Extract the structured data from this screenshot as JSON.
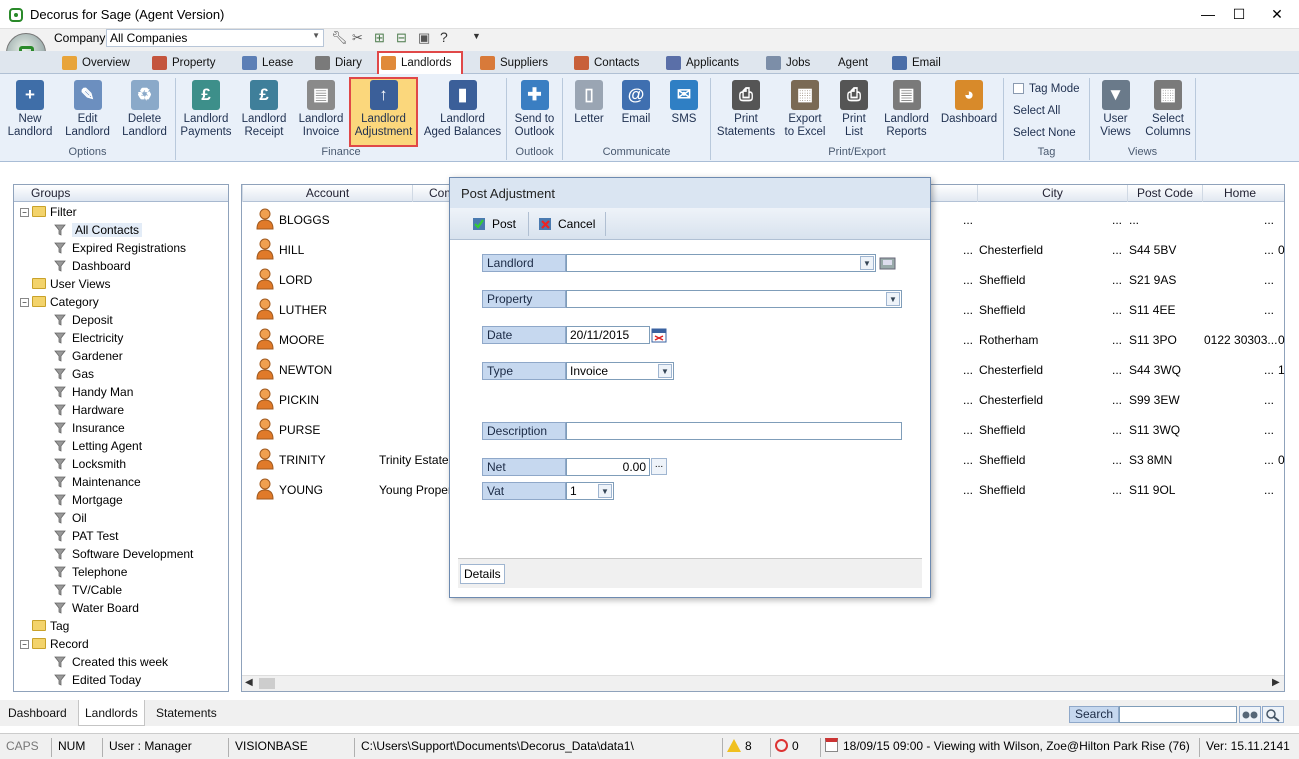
{
  "app": {
    "title": "Decorus for Sage (Agent Version)"
  },
  "window": {
    "minimize": "—",
    "maximize": "☐",
    "close": "✕"
  },
  "qat": {
    "company_label": "Company",
    "company_value": "All Companies"
  },
  "tabs": [
    {
      "label": "Overview",
      "color": "#e8a43a"
    },
    {
      "label": "Property",
      "color": "#c4553e"
    },
    {
      "label": "Lease",
      "color": "#5c7fb6"
    },
    {
      "label": "Diary",
      "color": "#7a7a7a"
    },
    {
      "label": "Landlords",
      "color": "#e08a3a",
      "active": true
    },
    {
      "label": "Suppliers",
      "color": "#d87a3a"
    },
    {
      "label": "Contacts",
      "color": "#c8603a"
    },
    {
      "label": "Applicants",
      "color": "#5a6fa8"
    },
    {
      "label": "Jobs",
      "color": "#7c8ea8"
    },
    {
      "label": "Agent",
      "color": ""
    },
    {
      "label": "Email",
      "color": "#4a6ea8"
    }
  ],
  "ribbon": {
    "buttons": [
      {
        "label": "New\nLandlord",
        "icon": "new-landlord-icon",
        "color": "#3f6ea8",
        "glyph": "+"
      },
      {
        "label": "Edit\nLandlord",
        "icon": "edit-landlord-icon",
        "color": "#6c8fbf",
        "glyph": "✎"
      },
      {
        "label": "Delete\nLandlord",
        "icon": "delete-landlord-icon",
        "color": "#8aa9c9",
        "glyph": "♻"
      },
      {
        "label": "Landlord\nPayments",
        "icon": "landlord-payments-icon",
        "color": "#3d8f8a",
        "glyph": "£"
      },
      {
        "label": "Landlord\nReceipt",
        "icon": "landlord-receipt-icon",
        "color": "#3f7f9a",
        "glyph": "£"
      },
      {
        "label": "Landlord\nInvoice",
        "icon": "landlord-invoice-icon",
        "color": "#8a8a8a",
        "glyph": "▤"
      },
      {
        "label": "Landlord\nAdjustment",
        "icon": "landlord-adjustment-icon",
        "color": "#3b5f99",
        "glyph": "↑"
      },
      {
        "label": "Landlord\nAged Balances",
        "icon": "aged-balances-icon",
        "color": "#3b5f99",
        "glyph": "▮"
      },
      {
        "label": "Send to\nOutlook",
        "icon": "send-to-outlook-icon",
        "color": "#3a7ec2",
        "glyph": "✚"
      },
      {
        "label": "Letter",
        "icon": "letter-icon",
        "color": "#9aa5b3",
        "glyph": "▯"
      },
      {
        "label": "Email",
        "icon": "email-icon",
        "color": "#3f6fb0",
        "glyph": "@"
      },
      {
        "label": "SMS",
        "icon": "sms-icon",
        "color": "#2f7fc4",
        "glyph": "✉"
      },
      {
        "label": "Print\nStatements",
        "icon": "print-statements-icon",
        "color": "#555",
        "glyph": "⎙"
      },
      {
        "label": "Export\nto Excel",
        "icon": "export-excel-icon",
        "color": "#7a6a55",
        "glyph": "▦"
      },
      {
        "label": "Print\nList",
        "icon": "print-list-icon",
        "color": "#555",
        "glyph": "⎙"
      },
      {
        "label": "Landlord\nReports",
        "icon": "landlord-reports-icon",
        "color": "#7a7a7a",
        "glyph": "▤"
      },
      {
        "label": "Dashboard",
        "icon": "dashboard-icon",
        "color": "#d88a2a",
        "glyph": "◕"
      },
      {
        "label": "User\nViews",
        "icon": "user-views-icon",
        "color": "#6a7a8a",
        "glyph": "▼"
      },
      {
        "label": "Select\nColumns",
        "icon": "select-columns-icon",
        "color": "#7a7a7a",
        "glyph": "▦"
      }
    ],
    "tag_mode": "Tag Mode",
    "select_all": "Select All",
    "select_none": "Select None",
    "groups": [
      "Options",
      "Finance",
      "Outlook",
      "Communicate",
      "Print/Export",
      "Tag",
      "Views"
    ]
  },
  "groups_panel": {
    "header": "Groups",
    "filter": "Filter",
    "filter_items": [
      "All Contacts",
      "Expired Registrations",
      "Dashboard"
    ],
    "user_views": "User Views",
    "category": "Category",
    "category_items": [
      "Deposit",
      "Electricity",
      "Gardener",
      "Gas",
      "Handy Man",
      "Hardware",
      "Insurance",
      "Letting Agent",
      "Locksmith",
      "Maintenance",
      "Mortgage",
      "Oil",
      "PAT Test",
      "Software Development",
      "Telephone",
      "TV/Cable",
      "Water Board"
    ],
    "tag": "Tag",
    "record": "Record",
    "record_items": [
      "Created this week",
      "Edited Today"
    ]
  },
  "grid": {
    "columns": {
      "account": "Account",
      "company": "Com",
      "city": "City",
      "postcode": "Post Code",
      "home": "Home"
    },
    "rows": [
      {
        "account": "BLOGGS",
        "company": "",
        "dots": "...",
        "city": "",
        "postcode": "...",
        "home": "...",
        "x": ""
      },
      {
        "account": "HILL",
        "company": "",
        "dots": "...",
        "city": "Chesterfield",
        "postcode": "S44 5BV",
        "home": "...",
        "x": "0"
      },
      {
        "account": "LORD",
        "company": "",
        "dots": "...",
        "city": "Sheffield",
        "postcode": "S21 9AS",
        "home": "...",
        "x": ""
      },
      {
        "account": "LUTHER",
        "company": "",
        "dots": "...",
        "city": "Sheffield",
        "postcode": "S11 4EE",
        "home": "...",
        "x": ""
      },
      {
        "account": "MOORE",
        "company": "",
        "dots": "...",
        "city": "Rotherham",
        "postcode": "S11 3PO",
        "home": "0122 30303...",
        "x": "0"
      },
      {
        "account": "NEWTON",
        "company": "",
        "dots": "...",
        "city": "Chesterfield",
        "postcode": "S44 3WQ",
        "home": "...",
        "x": "1"
      },
      {
        "account": "PICKIN",
        "company": "",
        "dots": "...",
        "city": "Chesterfield",
        "postcode": "S99 3EW",
        "home": "...",
        "x": ""
      },
      {
        "account": "PURSE",
        "company": "",
        "dots": "...",
        "city": "Sheffield",
        "postcode": "S11 3WQ",
        "home": "...",
        "x": ""
      },
      {
        "account": "TRINITY",
        "company": "Trinity Estates",
        "dots": "...",
        "city": "Sheffield",
        "postcode": "S3 8MN",
        "home": "...",
        "x": "0"
      },
      {
        "account": "YOUNG",
        "company": "Young Properti",
        "dots": "...",
        "city": "Sheffield",
        "postcode": "S11 9OL",
        "home": "...",
        "x": ""
      }
    ]
  },
  "dialog": {
    "title": "Post Adjustment",
    "post": "Post",
    "cancel": "Cancel",
    "fields": {
      "landlord": {
        "label": "Landlord",
        "value": ""
      },
      "property": {
        "label": "Property",
        "value": ""
      },
      "date": {
        "label": "Date",
        "value": "20/11/2015"
      },
      "type": {
        "label": "Type",
        "value": "Invoice"
      },
      "description": {
        "label": "Description",
        "value": ""
      },
      "net": {
        "label": "Net",
        "value": "0.00"
      },
      "vat": {
        "label": "Vat",
        "value": "1"
      }
    },
    "details_tab": "Details"
  },
  "bottom_tabs": [
    "Dashboard",
    "Landlords",
    "Statements"
  ],
  "search": {
    "label": "Search",
    "value": ""
  },
  "status": {
    "caps": "CAPS",
    "num": "NUM",
    "user": "User : Manager",
    "db": "VISIONBASE",
    "path": "C:\\Users\\Support\\Documents\\Decorus_Data\\data1\\",
    "alerts": "8",
    "alarms": "0",
    "diary": "18/09/15 09:00 - Viewing with Wilson, Zoe@Hilton Park Rise (76)",
    "version": "Ver: 15.11.2141"
  }
}
